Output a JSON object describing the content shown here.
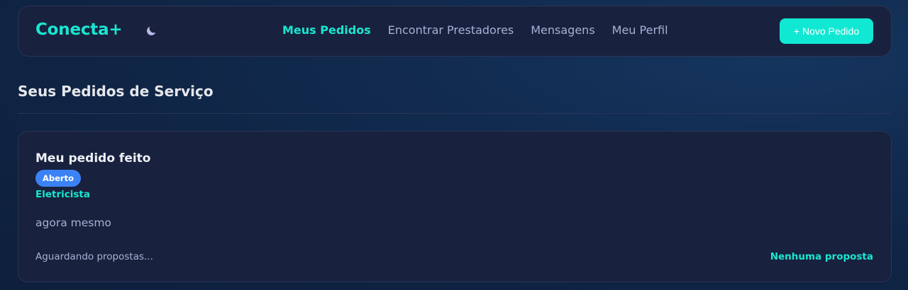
{
  "colors": {
    "accent": "#19e6d1",
    "button_bg": "#11e8d3",
    "badge_bg": "#3b82f6",
    "panel_bg": "#18213d",
    "muted_text": "#a7b1d6"
  },
  "header": {
    "brand": "Conecta+",
    "theme_toggle_icon": "moon-icon",
    "nav": [
      {
        "label": "Meus Pedidos",
        "active": true
      },
      {
        "label": "Encontrar Prestadores",
        "active": false
      },
      {
        "label": "Mensagens",
        "active": false
      },
      {
        "label": "Meu Perfil",
        "active": false
      }
    ],
    "new_request_button": "+ Novo Pedido"
  },
  "main": {
    "title": "Seus Pedidos de Serviço",
    "requests": [
      {
        "title": "Meu pedido feito",
        "status": "Aberto",
        "category": "Eletricista",
        "time": "agora mesmo",
        "footer_status": "Aguardando propostas...",
        "proposals": "Nenhuma proposta"
      }
    ]
  }
}
